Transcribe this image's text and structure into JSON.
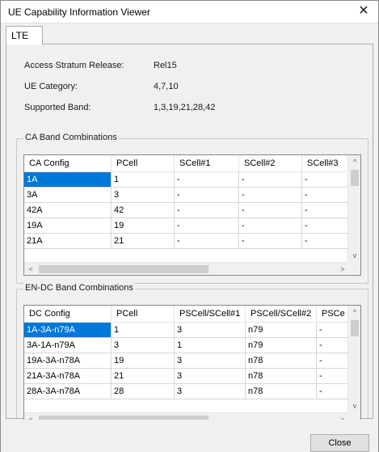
{
  "window": {
    "title": "UE Capability Information Viewer",
    "close_glyph": "✕"
  },
  "tabs": [
    {
      "label": "LTE"
    }
  ],
  "info": [
    {
      "label": "Access Stratum Release:",
      "value": "Rel15"
    },
    {
      "label": "UE Category:",
      "value": "4,7,10"
    },
    {
      "label": "Supported Band:",
      "value": "1,3,19,21,28,42"
    }
  ],
  "ca": {
    "title": "CA Band Combinations",
    "columns": [
      "CA Config",
      "PCell",
      "SCell#1",
      "SCell#2",
      "SCell#3"
    ],
    "rows": [
      [
        "1A",
        "1",
        "-",
        "-",
        "-"
      ],
      [
        "3A",
        "3",
        "-",
        "-",
        "-"
      ],
      [
        "42A",
        "42",
        "-",
        "-",
        "-"
      ],
      [
        "19A",
        "19",
        "-",
        "-",
        "-"
      ],
      [
        "21A",
        "21",
        "-",
        "-",
        "-"
      ]
    ]
  },
  "endc": {
    "title": "EN-DC Band Combinations",
    "columns": [
      "DC Config",
      "PCell",
      "PSCell/SCell#1",
      "PSCell/SCell#2",
      "PSCe"
    ],
    "rows": [
      [
        "1A-3A-n79A",
        "1",
        "3",
        "n79",
        "-"
      ],
      [
        "3A-1A-n79A",
        "3",
        "1",
        "n79",
        "-"
      ],
      [
        "19A-3A-n78A",
        "19",
        "3",
        "n78",
        "-"
      ],
      [
        "21A-3A-n78A",
        "21",
        "3",
        "n78",
        "-"
      ],
      [
        "28A-3A-n78A",
        "28",
        "3",
        "n78",
        "-"
      ]
    ]
  },
  "scroll_glyphs": {
    "up": "^",
    "down": "v",
    "left": "<",
    "right": ">"
  },
  "buttons": {
    "close": "Close"
  },
  "colors": {
    "selection": "#0078d7",
    "window_bg": "#f0f0f0"
  }
}
